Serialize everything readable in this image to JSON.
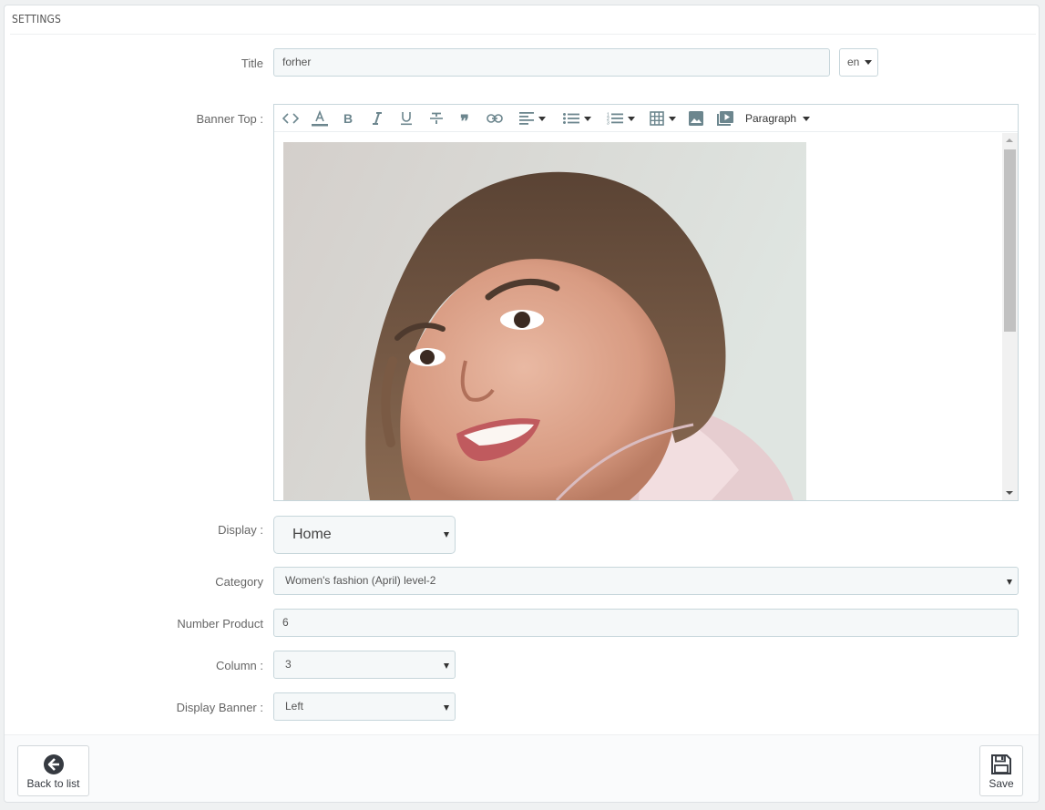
{
  "panel": {
    "heading": "SETTINGS"
  },
  "form": {
    "title": {
      "label": "Title",
      "value": "forher",
      "lang": "en"
    },
    "banner_top": {
      "label": "Banner Top :",
      "toolbar": {
        "items": [
          "code-view",
          "text-color",
          "bold",
          "italic",
          "underline",
          "strikethrough",
          "blockquote",
          "link",
          "align",
          "bullet-list",
          "numbered-list",
          "table",
          "image",
          "media"
        ],
        "format": "Paragraph"
      }
    },
    "display": {
      "label": "Display :",
      "value": "Home"
    },
    "category": {
      "label": "Category",
      "value": "Women's fashion (April) level-2"
    },
    "number_product": {
      "label": "Number Product",
      "value": "6"
    },
    "column": {
      "label": "Column :",
      "value": "3"
    },
    "display_banner": {
      "label": "Display Banner :",
      "value": "Left"
    }
  },
  "footer": {
    "back_label": "Back to list",
    "save_label": "Save"
  }
}
